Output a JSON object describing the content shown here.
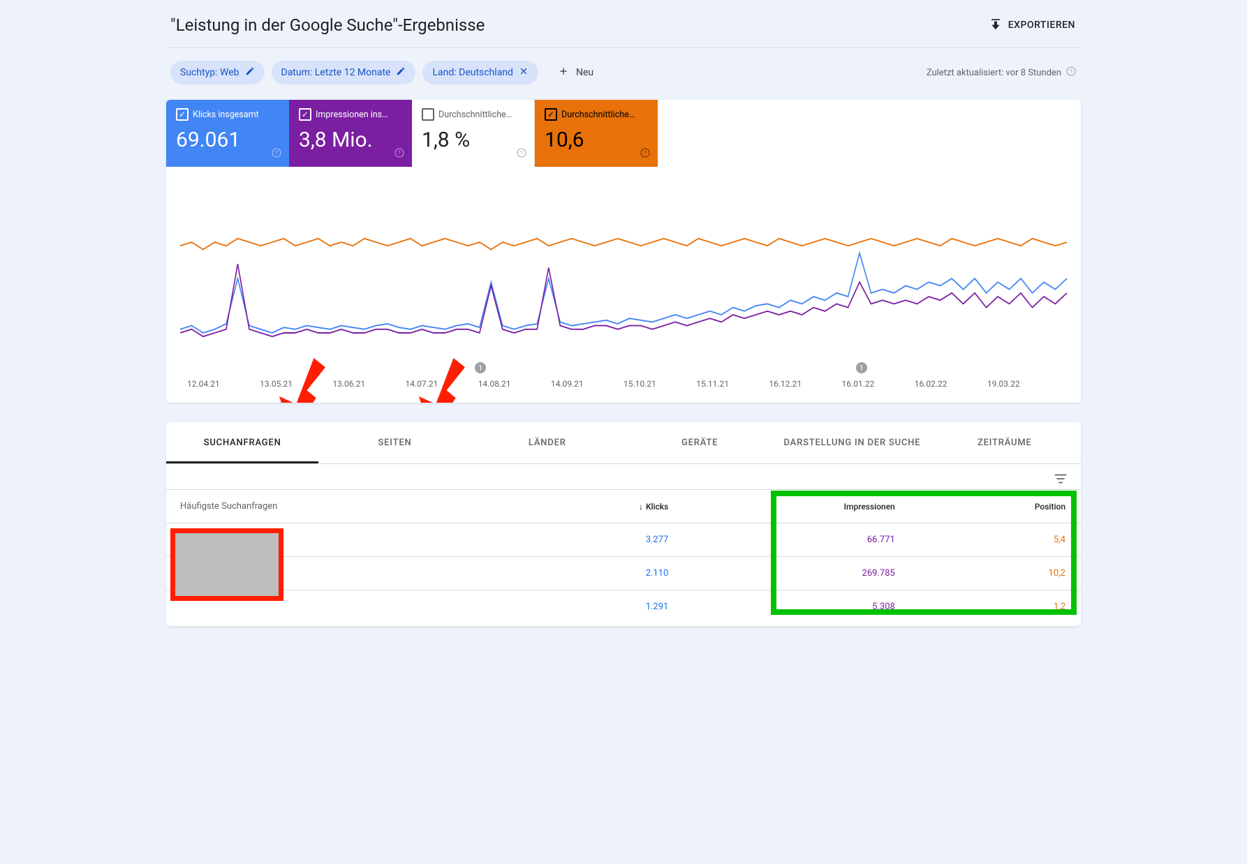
{
  "header": {
    "title": "\"Leistung in der Google Suche\"-Ergebnisse",
    "export_label": "EXPORTIEREN"
  },
  "filters": {
    "chips": [
      {
        "label": "Suchtyp: Web",
        "action": "edit"
      },
      {
        "label": "Datum: Letzte 12 Monate",
        "action": "edit"
      },
      {
        "label": "Land: Deutschland",
        "action": "close"
      }
    ],
    "add_new_label": "Neu",
    "updated_label": "Zuletzt aktualisiert: vor 8 Stunden"
  },
  "metrics": [
    {
      "key": "clicks",
      "label": "Klicks insgesamt",
      "value": "69.061",
      "checked": true
    },
    {
      "key": "impr",
      "label": "Impressionen ins…",
      "value": "3,8 Mio.",
      "checked": true
    },
    {
      "key": "ctr",
      "label": "Durchschnittliche…",
      "value": "1,8 %",
      "checked": false
    },
    {
      "key": "pos",
      "label": "Durchschnittliche…",
      "value": "10,6",
      "checked": true
    }
  ],
  "chart_data": {
    "type": "line",
    "xlabel": "",
    "ylabel": "",
    "x_ticks": [
      "12.04.21",
      "13.05.21",
      "13.06.21",
      "14.07.21",
      "14.08.21",
      "14.09.21",
      "15.10.21",
      "15.11.21",
      "16.12.21",
      "16.01.22",
      "16.02.22",
      "19.03.22"
    ],
    "markers": [
      {
        "after_index": 4,
        "label": "1"
      },
      {
        "after_index": 9,
        "label": "1"
      }
    ],
    "series": [
      {
        "name": "Klicks",
        "color": "#4285f4",
        "values": [
          22,
          24,
          20,
          22,
          25,
          50,
          24,
          22,
          20,
          23,
          22,
          24,
          23,
          22,
          24,
          23,
          22,
          24,
          25,
          23,
          22,
          24,
          23,
          22,
          24,
          25,
          23,
          48,
          24,
          22,
          24,
          25,
          50,
          26,
          24,
          25,
          26,
          27,
          25,
          28,
          27,
          26,
          28,
          30,
          28,
          30,
          32,
          30,
          34,
          32,
          35,
          36,
          34,
          38,
          36,
          40,
          38,
          42,
          40,
          64,
          42,
          44,
          42,
          46,
          44,
          48,
          46,
          50,
          44,
          50,
          42,
          48,
          44,
          50,
          42,
          48,
          44,
          50
        ]
      },
      {
        "name": "Impressionen",
        "color": "#7b1fa2",
        "values": [
          20,
          22,
          18,
          20,
          22,
          58,
          22,
          20,
          18,
          20,
          20,
          22,
          20,
          20,
          22,
          20,
          20,
          22,
          22,
          20,
          20,
          22,
          20,
          20,
          22,
          22,
          20,
          46,
          22,
          20,
          22,
          22,
          56,
          24,
          22,
          22,
          24,
          24,
          22,
          24,
          24,
          22,
          24,
          26,
          24,
          26,
          28,
          26,
          30,
          28,
          30,
          32,
          30,
          32,
          30,
          34,
          32,
          36,
          34,
          48,
          36,
          38,
          36,
          38,
          36,
          40,
          38,
          42,
          36,
          42,
          34,
          40,
          36,
          42,
          34,
          40,
          36,
          42
        ]
      },
      {
        "name": "Position",
        "color": "#e8710a",
        "values": [
          68,
          70,
          66,
          70,
          68,
          72,
          70,
          68,
          70,
          72,
          68,
          70,
          72,
          68,
          70,
          68,
          72,
          70,
          68,
          70,
          72,
          68,
          70,
          72,
          70,
          68,
          70,
          66,
          70,
          68,
          70,
          72,
          68,
          70,
          72,
          70,
          68,
          70,
          72,
          70,
          68,
          70,
          72,
          70,
          68,
          72,
          70,
          68,
          70,
          72,
          70,
          68,
          72,
          70,
          68,
          70,
          72,
          70,
          68,
          70,
          72,
          70,
          68,
          70,
          72,
          70,
          68,
          72,
          70,
          68,
          70,
          72,
          70,
          68,
          72,
          70,
          68,
          70
        ]
      }
    ]
  },
  "tabs": [
    "SUCHANFRAGEN",
    "SEITEN",
    "LÄNDER",
    "GERÄTE",
    "DARSTELLUNG IN DER SUCHE",
    "ZEITRÄUME"
  ],
  "active_tab": 0,
  "table": {
    "column_query": "Häufigste Suchanfragen",
    "columns": [
      "Klicks",
      "Impressionen",
      "Position"
    ],
    "sort_col": 0,
    "rows": [
      {
        "clicks": "3.277",
        "impr": "66.771",
        "pos": "5,4"
      },
      {
        "clicks": "2.110",
        "impr": "269.785",
        "pos": "10,2"
      },
      {
        "clicks": "1.291",
        "impr": "5.308",
        "pos": "1,2"
      }
    ]
  }
}
